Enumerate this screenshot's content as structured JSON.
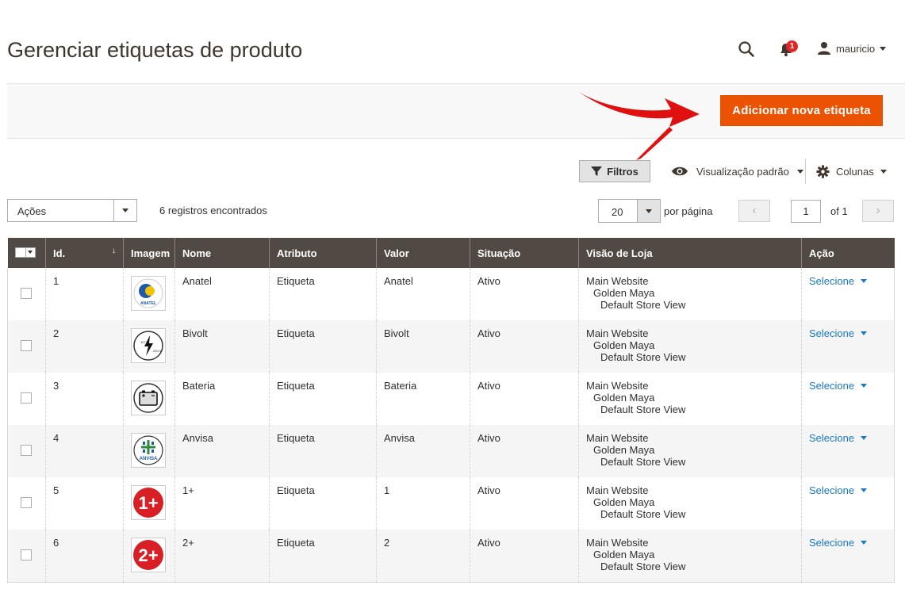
{
  "header": {
    "title": "Gerenciar etiquetas de produto",
    "notifications_count": "1",
    "user_name": "mauricio"
  },
  "action_bar": {
    "add_button": "Adicionar nova etiqueta"
  },
  "toolbar": {
    "filters_label": "Filtros",
    "view_label": "Visualização padrão",
    "columns_label": "Colunas",
    "actions_select": "Ações",
    "records_found": "6 registros encontrados",
    "per_page_value": "20",
    "per_page_label": "por página",
    "page_value": "1",
    "page_of": "of 1"
  },
  "grid": {
    "columns": [
      "Id.",
      "Imagem",
      "Nome",
      "Atributo",
      "Valor",
      "Situação",
      "Visão de Loja",
      "Ação"
    ],
    "rows": [
      {
        "id": "1",
        "image": "anatel-logo",
        "name": "Anatel",
        "attribute": "Etiqueta",
        "value": "Anatel",
        "status": "Ativo",
        "store1": "Main Website",
        "store2": "Golden Maya",
        "store3": "Default Store View",
        "action": "Selecione"
      },
      {
        "id": "2",
        "image": "bivolt-logo",
        "name": "Bivolt",
        "attribute": "Etiqueta",
        "value": "Bivolt",
        "status": "Ativo",
        "store1": "Main Website",
        "store2": "Golden Maya",
        "store3": "Default Store View",
        "action": "Selecione"
      },
      {
        "id": "3",
        "image": "battery-icon",
        "name": "Bateria",
        "attribute": "Etiqueta",
        "value": "Bateria",
        "status": "Ativo",
        "store1": "Main Website",
        "store2": "Golden Maya",
        "store3": "Default Store View",
        "action": "Selecione"
      },
      {
        "id": "4",
        "image": "anvisa-logo",
        "name": "Anvisa",
        "attribute": "Etiqueta",
        "value": "Anvisa",
        "status": "Ativo",
        "store1": "Main Website",
        "store2": "Golden Maya",
        "store3": "Default Store View",
        "action": "Selecione"
      },
      {
        "id": "5",
        "image": "one-plus-badge",
        "name": "1+",
        "attribute": "Etiqueta",
        "value": "1",
        "status": "Ativo",
        "store1": "Main Website",
        "store2": "Golden Maya",
        "store3": "Default Store View",
        "action": "Selecione"
      },
      {
        "id": "6",
        "image": "two-plus-badge",
        "name": "2+",
        "attribute": "Etiqueta",
        "value": "2",
        "status": "Ativo",
        "store1": "Main Website",
        "store2": "Golden Maya",
        "store3": "Default Store View",
        "action": "Selecione"
      }
    ]
  },
  "thumbs": {
    "anatel_text": "ANATEL",
    "bivolt_top": "127 V",
    "bivolt_bottom": "220 V",
    "anvisa_text": "ANVISA",
    "one_plus_text": "1+",
    "two_plus_text": "2+"
  },
  "colors": {
    "accent": "#eb5202",
    "header_bg": "#514943",
    "link": "#1979c3",
    "badge": "#e22626",
    "annotation_arrow": "#e01010"
  }
}
